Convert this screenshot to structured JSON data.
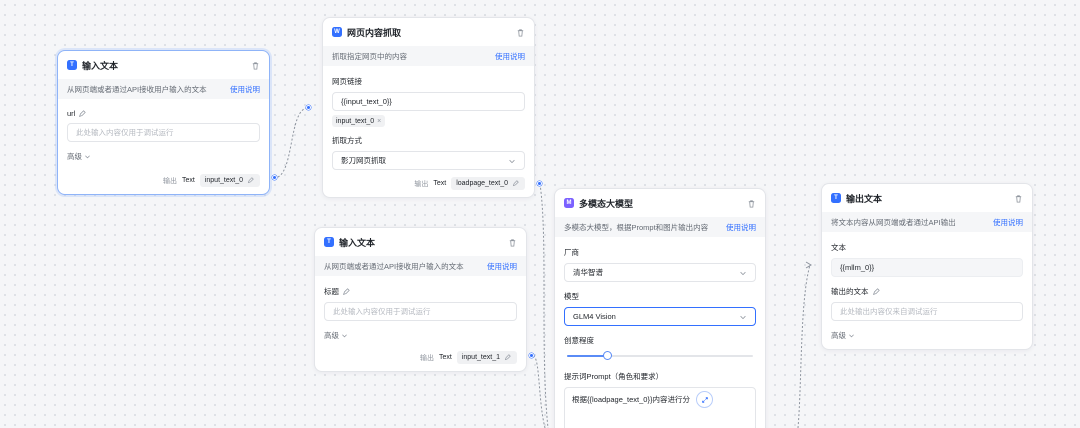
{
  "icons": {
    "text": "T",
    "web": "W",
    "multimodal": "M",
    "trash": "trash-icon",
    "pencil": "pencil-icon",
    "chevron": "chevron-down-icon",
    "expand": "expand-icon"
  },
  "colors": {
    "accent": "#3370ff",
    "selected_border": "#8fb4f8",
    "edge": "#8c939d"
  },
  "input_text_1": {
    "title": "输入文本",
    "description": "从网页端或者通过API接收用户输入的文本",
    "help": "使用说明",
    "field_label": "url",
    "field_placeholder": "此处输入内容仅用于调试运行",
    "advanced": "高级",
    "output_label": "输出",
    "output_type": "Text",
    "output_var": "input_text_0"
  },
  "web_scrape": {
    "title": "网页内容抓取",
    "description": "抓取指定网页中的内容",
    "help": "使用说明",
    "link_label": "网页链接",
    "link_value": "{{input_text_0}}",
    "link_tag": "input_text_0",
    "mode_label": "抓取方式",
    "mode_value": "影刀网页抓取",
    "output_label": "输出",
    "output_type": "Text",
    "output_var": "loadpage_text_0"
  },
  "input_text_2": {
    "title": "输入文本",
    "description": "从网页端或者通过API接收用户输入的文本",
    "help": "使用说明",
    "field_label": "标题",
    "field_placeholder": "此处输入内容仅用于调试运行",
    "advanced": "高级",
    "output_label": "输出",
    "output_type": "Text",
    "output_var": "input_text_1"
  },
  "multimodal": {
    "title": "多模态大模型",
    "description": "多模态大模型，根据Prompt和图片输出内容",
    "help": "使用说明",
    "vendor_label": "厂商",
    "vendor_value": "清华智谱",
    "model_label": "模型",
    "model_value": "GLM4 Vision",
    "creativity_label": "创意程度",
    "creativity_value": 0.22,
    "prompt_label": "提示词Prompt（角色和要求）",
    "prompt_value": "根据{{loadpage_text_0}}内容进行分"
  },
  "output_text": {
    "title": "输出文本",
    "description": "将文本内容从网页端或者通过API输出",
    "help": "使用说明",
    "text_label": "文本",
    "text_value": "{{mllm_0}}",
    "debug_label": "输出的文本",
    "debug_placeholder": "此处输出内容仅来自调试运行",
    "advanced": "高级"
  }
}
